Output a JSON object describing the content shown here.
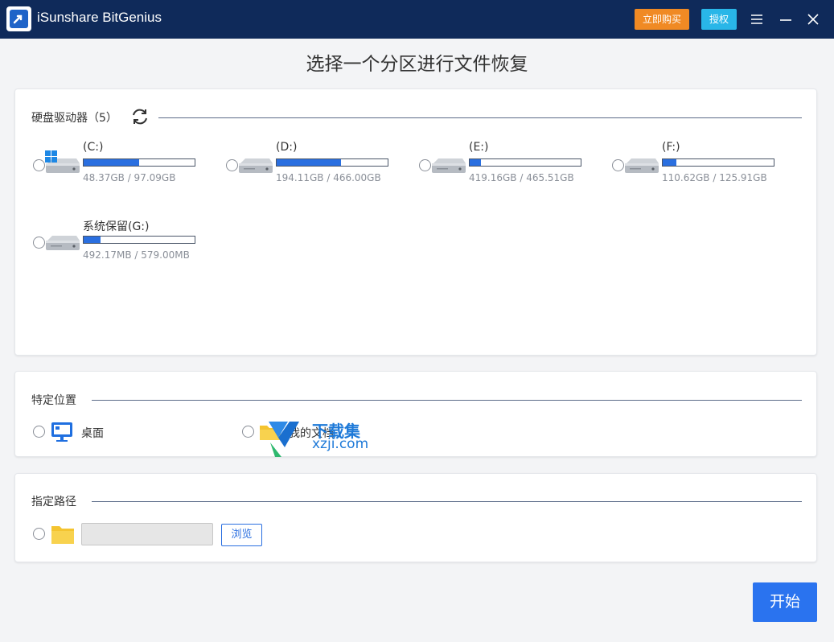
{
  "app": {
    "title": "iSunshare BitGenius",
    "buy_label": "立即购买",
    "auth_label": "授权",
    "page_title": "选择一个分区进行文件恢复",
    "accent_color": "#2a73ef",
    "titlebar_color": "#0f2a5a"
  },
  "drives_panel": {
    "heading": "硬盘驱动器（5）",
    "refresh_icon": "refresh-icon",
    "drives": [
      {
        "label": "(C:)",
        "size": "48.37GB / 97.09GB",
        "used_fraction": 0.5,
        "system": true
      },
      {
        "label": "(D:)",
        "size": "194.11GB / 466.00GB",
        "used_fraction": 0.58,
        "system": false
      },
      {
        "label": "(E:)",
        "size": "419.16GB / 465.51GB",
        "used_fraction": 0.1,
        "system": false
      },
      {
        "label": "(F:)",
        "size": "110.62GB / 125.91GB",
        "used_fraction": 0.12,
        "system": false
      },
      {
        "label": "系统保留(G:)",
        "size": "492.17MB / 579.00MB",
        "used_fraction": 0.15,
        "system": false
      }
    ]
  },
  "location_panel": {
    "heading": "特定位置",
    "items": [
      {
        "label": "桌面",
        "icon": "desktop-icon"
      },
      {
        "label": "我的文档",
        "icon": "folder-icon"
      }
    ]
  },
  "path_panel": {
    "heading": "指定路径",
    "input_value": "",
    "browse_label": "浏览"
  },
  "start_label": "开始",
  "watermark": {
    "title": "下载集",
    "url": "xzji.com"
  }
}
